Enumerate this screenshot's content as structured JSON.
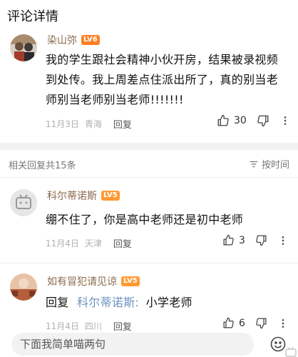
{
  "header": {
    "title": "评论详情"
  },
  "main_comment": {
    "username": "染山弥",
    "level": "LV6",
    "level_color": "#ff7f24",
    "text_lines": [
      "我的学生跟社会精神小伙开房，结果被录视频",
      "到处传。我上周差点住派出所了，真的别当老",
      "师别当老师别当老师!!!!!!!"
    ],
    "date": "11月3日",
    "location": "青海",
    "reply_label": "回复",
    "likes": "30"
  },
  "reply_section": {
    "count_label": "相关回复共15条",
    "sort_label": "按时间"
  },
  "replies": [
    {
      "username": "科尔蒂诺斯",
      "level": "LV5",
      "level_color": "#ff9a33",
      "text": "绷不住了，你是高中老师还是初中老师",
      "date": "11月4日",
      "location": "天津",
      "reply_label": "回复",
      "likes": "3"
    },
    {
      "username": "如有冒犯请见谅",
      "level": "LV5",
      "level_color": "#ff9a33",
      "reply_prefix": "回复",
      "reply_target": "科尔蒂诺斯:",
      "text": "小学老师",
      "date": "11月4日",
      "location": "四川",
      "reply_label": "回复",
      "likes": "6"
    }
  ],
  "input": {
    "placeholder": "下面我简单喵两句"
  },
  "colors": {
    "username": "#8a6a4b",
    "link": "#6b93c0",
    "meta": "#b0b0b0"
  }
}
